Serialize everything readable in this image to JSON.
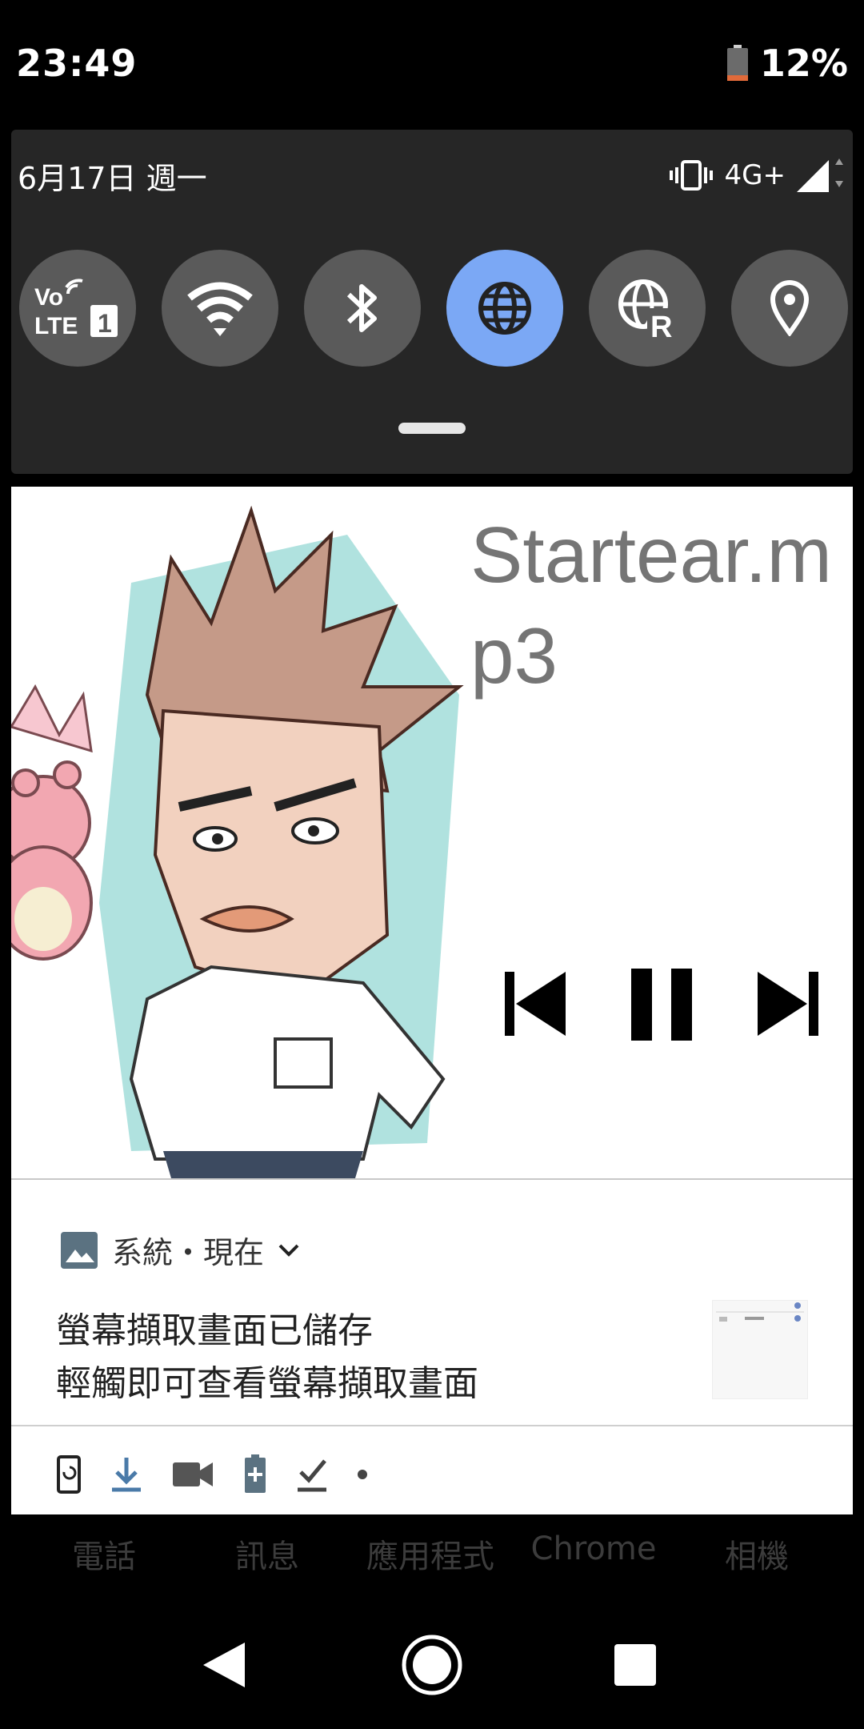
{
  "status_bar": {
    "time": "23:49",
    "battery_percent": "12%"
  },
  "quick_settings": {
    "date": "6月17日 週一",
    "network_type": "4G+",
    "tiles": [
      {
        "name": "volte",
        "icon": "volte-icon",
        "active": false
      },
      {
        "name": "wifi",
        "icon": "wifi-icon",
        "active": false
      },
      {
        "name": "bluetooth",
        "icon": "bluetooth-icon",
        "active": false
      },
      {
        "name": "mobile-data",
        "icon": "globe-icon",
        "active": true
      },
      {
        "name": "roaming",
        "icon": "globe-roaming-icon",
        "active": false
      },
      {
        "name": "location",
        "icon": "location-pin-icon",
        "active": false
      }
    ],
    "accent_color": "#7ba8f5"
  },
  "media": {
    "title": "Startear.mp3",
    "controls": [
      "previous-icon",
      "pause-icon",
      "next-icon"
    ]
  },
  "notification": {
    "app": "系統・現在",
    "title": "螢幕擷取畫面已儲存",
    "text": "輕觸即可查看螢幕擷取畫面",
    "status_icons": [
      "phone-rotate-icon",
      "download-icon",
      "video-camera-icon",
      "battery-plus-icon",
      "check-download-icon",
      "dot-icon"
    ]
  },
  "dock": {
    "labels": [
      "電話",
      "訊息",
      "應用程式",
      "Chrome",
      "相機"
    ]
  },
  "navigation": [
    "back-icon",
    "home-icon",
    "recents-icon"
  ]
}
